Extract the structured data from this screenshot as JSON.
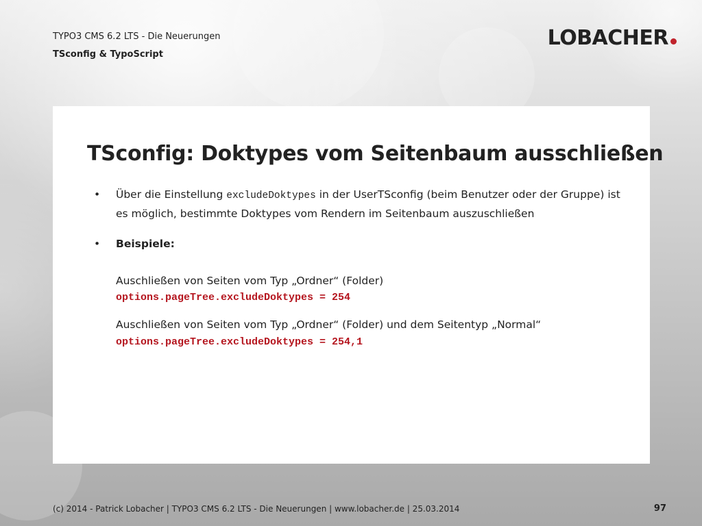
{
  "colors": {
    "accent": "#c0232c",
    "code": "#b5161f",
    "text": "#222222"
  },
  "header": {
    "presentation_title": "TYPO3 CMS 6.2 LTS - Die Neuerungen",
    "section": "TSconfig & TypoScript"
  },
  "logo": {
    "text": "LOBACHER"
  },
  "slide": {
    "title": "TSconfig: Doktypes vom Seitenbaum ausschließen",
    "bullets": [
      {
        "marker": "•",
        "text_before": "Über die Einstellung ",
        "code": "excludeDoktypes",
        "text_after": " in der UserTSconfig (beim Benutzer oder der Gruppe) ist es möglich, bestimmte Doktypes vom Rendern im Seitenbaum auszuschließen"
      },
      {
        "marker": "•",
        "text": "Beispiele:"
      }
    ],
    "examples": [
      {
        "description": "Auschließen von Seiten vom Typ „Ordner“ (Folder)",
        "code": "options.pageTree.excludeDoktypes = 254"
      },
      {
        "description": "Auschließen von Seiten vom Typ „Ordner“ (Folder) und dem Seitentyp „Normal“",
        "code": "options.pageTree.excludeDoktypes = 254,1"
      }
    ]
  },
  "footer": {
    "text": "(c) 2014 - Patrick Lobacher | TYPO3 CMS 6.2 LTS - Die Neuerungen | www.lobacher.de | 25.03.2014",
    "page_number": "97"
  }
}
